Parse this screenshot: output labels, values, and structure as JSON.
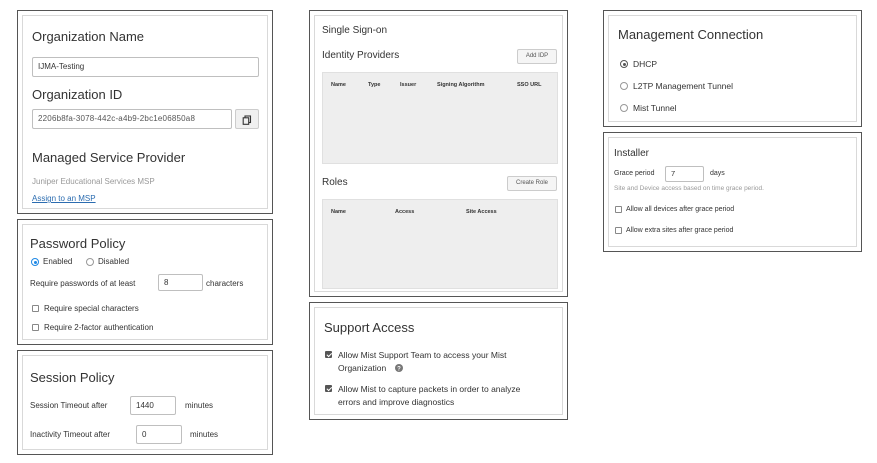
{
  "organization": {
    "name_heading": "Organization Name",
    "name_value": "IJMA-Testing",
    "id_heading": "Organization ID",
    "id_value": "2206b8fa-3078-442c-a4b9-2bc1e06850a8",
    "copy_icon": "copy-icon",
    "msp_heading": "Managed Service Provider",
    "msp_value": "Juniper Educational Services MSP",
    "msp_link": "Assign to an MSP"
  },
  "password_policy": {
    "heading": "Password Policy",
    "enabled_label": "Enabled",
    "disabled_label": "Disabled",
    "selected": "Enabled",
    "min_length_prefix": "Require passwords of at least",
    "min_length_value": "8",
    "min_length_suffix": "characters",
    "require_special_label": "Require special characters",
    "require_2fa_label": "Require 2-factor authentication"
  },
  "session_policy": {
    "heading": "Session Policy",
    "session_timeout_label": "Session Timeout after",
    "session_timeout_value": "1440",
    "session_timeout_unit": "minutes",
    "inactivity_timeout_label": "Inactivity Timeout after",
    "inactivity_timeout_value": "0",
    "inactivity_timeout_unit": "minutes"
  },
  "sso": {
    "heading": "Single Sign-on",
    "idp_heading": "Identity Providers",
    "add_idp_label": "Add IDP",
    "idp_columns": [
      "Name",
      "Type",
      "Issuer",
      "Signing Algorithm",
      "SSO URL"
    ],
    "roles_heading": "Roles",
    "create_role_label": "Create Role",
    "roles_columns": [
      "Name",
      "Access",
      "Site Access"
    ]
  },
  "support_access": {
    "heading": "Support Access",
    "allow_support_label_line1": "Allow Mist Support Team to access your Mist",
    "allow_support_label_line2": "Organization",
    "help_icon": "help-icon",
    "allow_support_checked": true,
    "allow_capture_label_line1": "Allow Mist to capture packets in order to analyze",
    "allow_capture_label_line2": "errors and improve diagnostics",
    "allow_capture_checked": true
  },
  "management_connection": {
    "heading": "Management Connection",
    "options": [
      "DHCP",
      "L2TP Management Tunnel",
      "Mist Tunnel"
    ],
    "selected": "DHCP"
  },
  "installer": {
    "heading": "Installer",
    "grace_label": "Grace period",
    "grace_value": "7",
    "grace_unit": "days",
    "grace_hint": "Site and Device access based on time grace period.",
    "allow_devices_label": "Allow all devices after grace period",
    "allow_sites_label": "Allow extra sites after grace period"
  }
}
